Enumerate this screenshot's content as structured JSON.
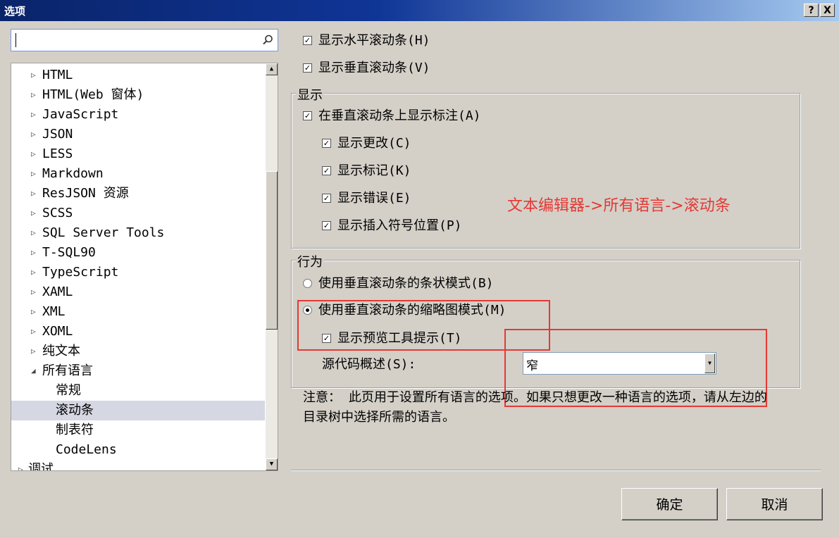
{
  "window": {
    "title": "选项",
    "help_label": "?",
    "close_label": "X"
  },
  "search": {
    "value": "",
    "placeholder": ""
  },
  "tree": {
    "items": [
      {
        "label": "HTML",
        "arrow": "▷"
      },
      {
        "label": "HTML(Web 窗体)",
        "arrow": "▷"
      },
      {
        "label": "JavaScript",
        "arrow": "▷"
      },
      {
        "label": "JSON",
        "arrow": "▷"
      },
      {
        "label": "LESS",
        "arrow": "▷"
      },
      {
        "label": "Markdown",
        "arrow": "▷"
      },
      {
        "label": "ResJSON 资源",
        "arrow": "▷"
      },
      {
        "label": "SCSS",
        "arrow": "▷"
      },
      {
        "label": "SQL Server Tools",
        "arrow": "▷"
      },
      {
        "label": "T-SQL90",
        "arrow": "▷"
      },
      {
        "label": "TypeScript",
        "arrow": "▷"
      },
      {
        "label": "XAML",
        "arrow": "▷"
      },
      {
        "label": "XML",
        "arrow": "▷"
      },
      {
        "label": "XOML",
        "arrow": "▷"
      },
      {
        "label": "纯文本",
        "arrow": "▷"
      },
      {
        "label": "所有语言",
        "arrow": "◢"
      },
      {
        "label": "常规",
        "arrow": ""
      },
      {
        "label": "滚动条",
        "arrow": "",
        "selected": true
      },
      {
        "label": "制表符",
        "arrow": ""
      },
      {
        "label": "CodeLens",
        "arrow": ""
      },
      {
        "label": "调试",
        "arrow": "▷"
      }
    ]
  },
  "options": {
    "show_hscroll": {
      "label": "显示水平滚动条(H)",
      "checked": true
    },
    "show_vscroll": {
      "label": "显示垂直滚动条(V)",
      "checked": true
    }
  },
  "display_group": {
    "title": "显示",
    "show_annotations": {
      "label": "在垂直滚动条上显示标注(A)",
      "checked": true
    },
    "show_changes": {
      "label": "显示更改(C)",
      "checked": true
    },
    "show_marks": {
      "label": "显示标记(K)",
      "checked": true
    },
    "show_errors": {
      "label": "显示错误(E)",
      "checked": true
    },
    "show_caret": {
      "label": "显示插入符号位置(P)",
      "checked": true
    }
  },
  "behavior_group": {
    "title": "行为",
    "bar_mode": {
      "label": "使用垂直滚动条的条状模式(B)",
      "selected": false
    },
    "map_mode": {
      "label": "使用垂直滚动条的缩略图模式(M)",
      "selected": true
    },
    "show_preview": {
      "label": "显示预览工具提示(T)",
      "checked": true
    },
    "source_overview": {
      "label": "源代码概述(S):",
      "value": "窄"
    }
  },
  "annotation": {
    "text": "文本编辑器->所有语言->滚动条",
    "color": "#e53935"
  },
  "note": {
    "text": "注意： 此页用于设置所有语言的选项。如果只想更改一种语言的选项，请从左边的目录树中选择所需的语言。"
  },
  "buttons": {
    "ok_label": "确定",
    "cancel_label": "取消"
  },
  "icons": {
    "check": "✓",
    "scroll_up": "▲",
    "scroll_down": "▼",
    "dropdown": "▼"
  }
}
